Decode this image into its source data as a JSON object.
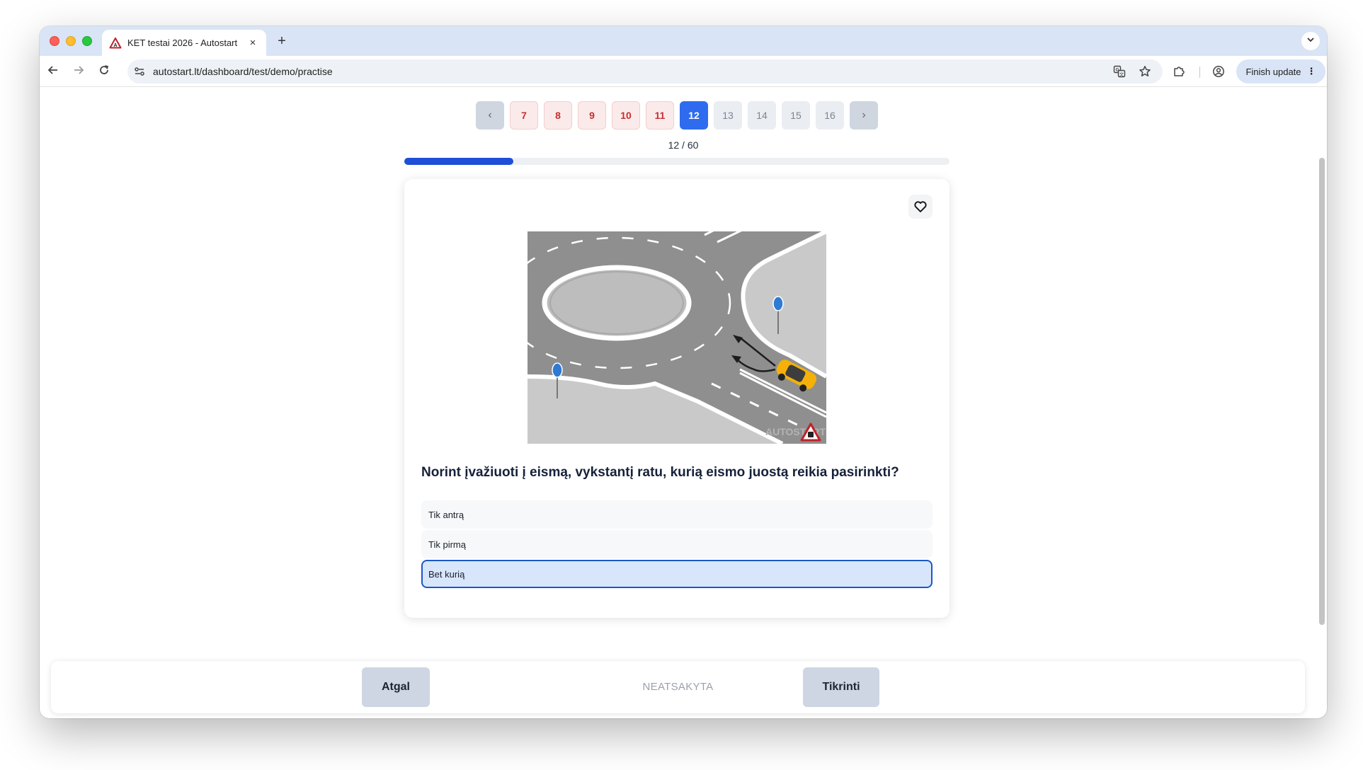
{
  "browser": {
    "tab_title": "KET testai 2026 - Autostart",
    "tab_close": "×",
    "new_tab": "+",
    "url": "autostart.lt/dashboard/test/demo/practise",
    "finish_update_label": "Finish update",
    "menu_glyph": "⋮"
  },
  "pagination": {
    "prev_glyph": "‹",
    "next_glyph": "›",
    "pages": [
      {
        "label": "7",
        "state": "wrong"
      },
      {
        "label": "8",
        "state": "wrong"
      },
      {
        "label": "9",
        "state": "wrong"
      },
      {
        "label": "10",
        "state": "wrong"
      },
      {
        "label": "11",
        "state": "wrong"
      },
      {
        "label": "12",
        "state": "current"
      },
      {
        "label": "13",
        "state": "todo"
      },
      {
        "label": "14",
        "state": "todo"
      },
      {
        "label": "15",
        "state": "todo"
      },
      {
        "label": "16",
        "state": "todo"
      }
    ]
  },
  "progress": {
    "label": "12 / 60",
    "current": 12,
    "total": 60
  },
  "question": {
    "text": "Norint įvažiuoti į eismą, vykstantį ratu, kurią eismo juostą reikia pasirinkti?",
    "image_watermark": "AUTOSTART",
    "answers": [
      {
        "label": "Tik antrą",
        "selected": false
      },
      {
        "label": "Tik pirmą",
        "selected": false
      },
      {
        "label": "Bet kurią",
        "selected": true
      }
    ]
  },
  "footer": {
    "back_label": "Atgal",
    "status_label": "NEATSAKYTA",
    "check_label": "Tikrinti"
  },
  "colors": {
    "accent": "#2e6bef",
    "progress": "#1e4fd8",
    "wrong": "#c62f2f",
    "selected_border": "#1d57c6"
  }
}
